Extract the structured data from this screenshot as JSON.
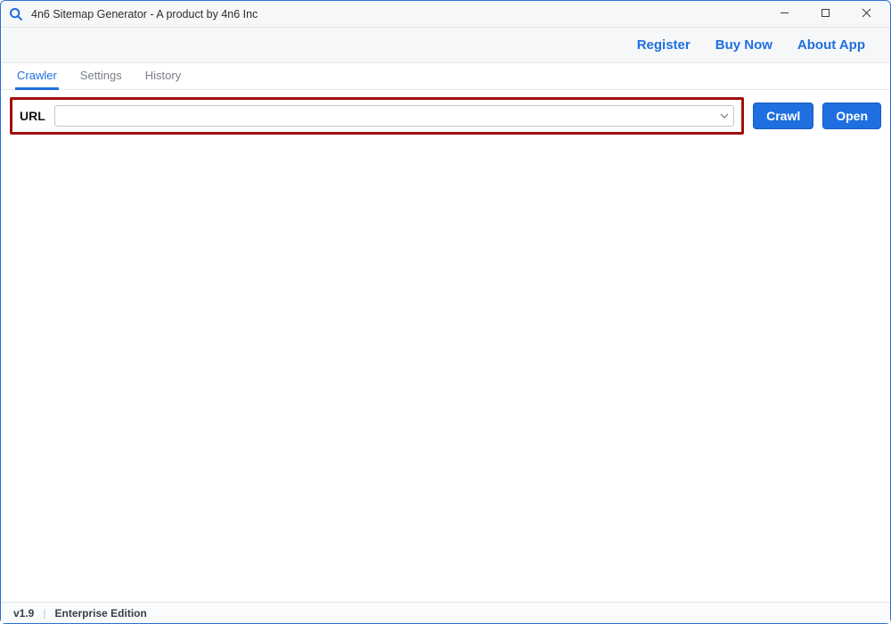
{
  "window": {
    "title": "4n6 Sitemap Generator - A product by 4n6 Inc"
  },
  "header_links": {
    "register": "Register",
    "buy_now": "Buy Now",
    "about": "About App"
  },
  "tabs": {
    "crawler": "Crawler",
    "settings": "Settings",
    "history": "History"
  },
  "url_row": {
    "label": "URL",
    "value": "",
    "placeholder": "",
    "crawl_label": "Crawl",
    "open_label": "Open"
  },
  "statusbar": {
    "version": "v1.9",
    "edition": "Enterprise Edition"
  },
  "icons": {
    "app": "search-icon",
    "minimize": "minimize-icon",
    "maximize": "maximize-icon",
    "close": "close-icon",
    "chevron": "chevron-down-icon"
  }
}
